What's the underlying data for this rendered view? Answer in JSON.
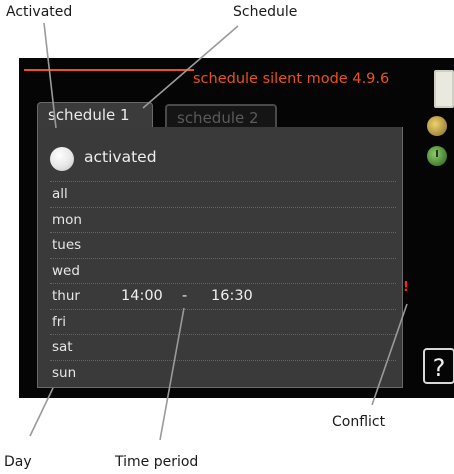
{
  "callouts": {
    "activated": "Activated",
    "schedule": "Schedule",
    "conflict": "Conflict",
    "day": "Day",
    "time_period": "Time period"
  },
  "screen": {
    "title": "schedule silent mode 4.9.6",
    "tabs": [
      {
        "label": "schedule 1",
        "active": true
      },
      {
        "label": "schedule 2",
        "active": false
      }
    ],
    "activated_label": "activated",
    "activated_on": false,
    "rows": [
      {
        "day": "all",
        "start": "",
        "sep": "",
        "end": ""
      },
      {
        "day": "mon",
        "start": "",
        "sep": "",
        "end": ""
      },
      {
        "day": "tues",
        "start": "",
        "sep": "",
        "end": ""
      },
      {
        "day": "wed",
        "start": "",
        "sep": "",
        "end": ""
      },
      {
        "day": "thur",
        "start": "14:00",
        "sep": "-",
        "end": "16:30"
      },
      {
        "day": "fri",
        "start": "",
        "sep": "",
        "end": ""
      },
      {
        "day": "sat",
        "start": "",
        "sep": "",
        "end": ""
      },
      {
        "day": "sun",
        "start": "",
        "sep": "",
        "end": ""
      }
    ],
    "conflict_mark": "!",
    "help_label": "?",
    "icons": [
      "scroll-handle",
      "sun-icon",
      "clock-icon"
    ],
    "colors": {
      "accent": "#e8541a",
      "conflict": "#ff2020",
      "panel": "#3a3a3a",
      "background": "#050505"
    }
  }
}
